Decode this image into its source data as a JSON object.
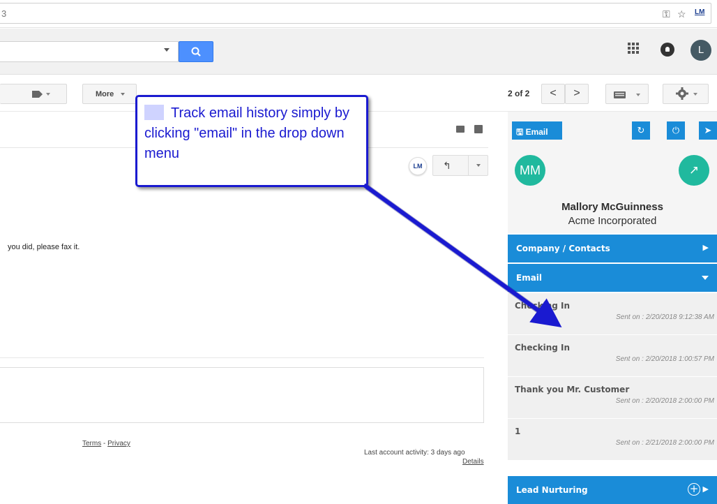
{
  "browser": {
    "url_fragment": "3",
    "key_icon": "key-icon",
    "star_icon": "star-icon",
    "extension_label": "LM"
  },
  "gmail_header": {
    "search_icon": "search-icon",
    "apps_icon": "apps-grid-icon",
    "notifications_icon": "notifications-icon",
    "avatar_initial": "L"
  },
  "toolbar": {
    "label_icon": "label-icon",
    "more_label": "More",
    "pager_text": "2 of 2",
    "prev_icon": "<",
    "next_icon": ">",
    "keyboard_icon": "keyboard-icon",
    "settings_icon": "gear-icon"
  },
  "message": {
    "print_icon": "print-icon",
    "popout_icon": "popout-icon",
    "extension_badge": "LM",
    "reply_icon": "reply-icon",
    "body_fragment": "you did, please fax it."
  },
  "footer": {
    "terms_label": "Terms",
    "separator": "-",
    "privacy_label": "Privacy",
    "last_activity": "Last account activity: 3 days ago",
    "details_label": "Details"
  },
  "callout": {
    "text": "Track email history simply by clicking \"email\" in the drop down menu"
  },
  "sidebar": {
    "email_button_label": "Email",
    "save_icon": "save-icon",
    "refresh_icon": "refresh-icon",
    "power_icon": "power-icon",
    "send_icon": "send-icon",
    "contact_initials": "MM",
    "open_icon": "external-link-icon",
    "contact_name": "Mallory McGuinness",
    "contact_company": "Acme Incorporated",
    "sections": {
      "company_contacts": "Company / Contacts",
      "email": "Email",
      "lead_nurturing": "Lead Nurturing"
    },
    "emails": [
      {
        "subject": "Checking In",
        "sent": "Sent on : 2/20/2018 9:12:38 AM"
      },
      {
        "subject": "Checking In",
        "sent": "Sent on : 2/20/2018 1:00:57 PM"
      },
      {
        "subject": "Thank you Mr. Customer",
        "sent": "Sent on : 2/20/2018 2:00:00 PM"
      },
      {
        "subject": "1",
        "sent": "Sent on : 2/21/2018 2:00:00 PM"
      }
    ]
  },
  "colors": {
    "sidebar_blue": "#1a8cd8",
    "avatar_teal": "#20b99e",
    "callout_blue": "#1a1ad0",
    "gmail_search_blue": "#4d90fe"
  }
}
